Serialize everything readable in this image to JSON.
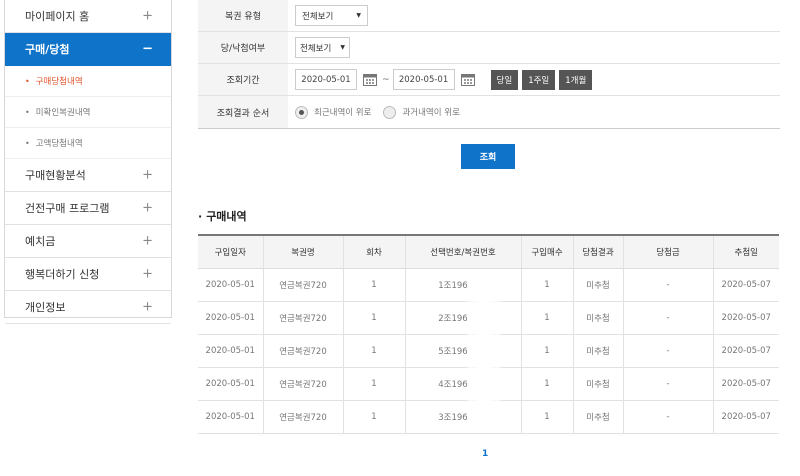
{
  "sidebar": {
    "items": [
      {
        "label": "마이페이지 홈",
        "toggle": "+"
      },
      {
        "label": "구매/당첨",
        "toggle": "−"
      },
      {
        "label": "구매현황분석",
        "toggle": "+"
      },
      {
        "label": "건전구매 프로그램",
        "toggle": "+"
      },
      {
        "label": "예치금",
        "toggle": "+"
      },
      {
        "label": "행복더하기 신청",
        "toggle": "+"
      },
      {
        "label": "개인정보",
        "toggle": "+"
      }
    ],
    "sub_items": [
      {
        "label": "구매당첨내역"
      },
      {
        "label": "미확인복권내역"
      },
      {
        "label": "고액당첨내역"
      }
    ]
  },
  "filter": {
    "lottery_type": {
      "label": "복권 유형",
      "value": "전체보기"
    },
    "win_status": {
      "label": "당/낙첨여부",
      "value": "전체보기"
    },
    "period": {
      "label": "조회기간",
      "start": "2020-05-01",
      "end": "2020-05-01",
      "separator": "~",
      "buttons": [
        "당일",
        "1주일",
        "1개월"
      ]
    },
    "order": {
      "label": "조회결과 순서",
      "options": [
        "최근내역이 위로",
        "과거내역이 위로"
      ],
      "selected": "최근내역이 위로"
    }
  },
  "search_button": "조회",
  "section_title": "구매내역",
  "table": {
    "headers": [
      "구입일자",
      "복권명",
      "회차",
      "선택번호/복권번호",
      "구입매수",
      "당첨결과",
      "당첨금",
      "추첨일"
    ],
    "rows": [
      [
        "2020-05-01",
        "연금복권720",
        "1",
        "1조196",
        "1",
        "미추첨",
        "-",
        "2020-05-07"
      ],
      [
        "2020-05-01",
        "연금복권720",
        "1",
        "2조196",
        "1",
        "미추첨",
        "-",
        "2020-05-07"
      ],
      [
        "2020-05-01",
        "연금복권720",
        "1",
        "5조196",
        "1",
        "미추첨",
        "-",
        "2020-05-07"
      ],
      [
        "2020-05-01",
        "연금복권720",
        "1",
        "4조196",
        "1",
        "미추첨",
        "-",
        "2020-05-07"
      ],
      [
        "2020-05-01",
        "연금복권720",
        "1",
        "3조196",
        "1",
        "미추첨",
        "-",
        "2020-05-07"
      ]
    ]
  },
  "pagination": {
    "current": "1"
  },
  "colors": {
    "accent": "#0f74c9",
    "active_sub": "#e0522a",
    "period_button": "#555555"
  }
}
